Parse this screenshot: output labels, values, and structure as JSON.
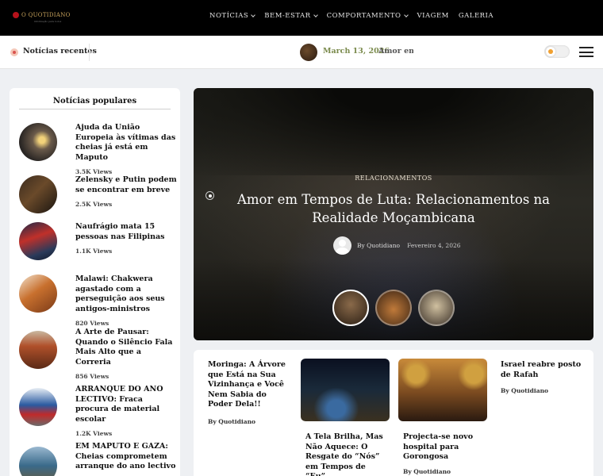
{
  "header": {
    "logo_text": "O QUOTIDIANO",
    "logo_tagline": "informação para todos",
    "nav": [
      {
        "label": "NOTÍCIAS",
        "has_dropdown": true
      },
      {
        "label": "BEM-ESTAR",
        "has_dropdown": true
      },
      {
        "label": "COMPORTAMENTO",
        "has_dropdown": true
      },
      {
        "label": "VIAGEM",
        "has_dropdown": false
      },
      {
        "label": "GALERIA",
        "has_dropdown": false
      }
    ]
  },
  "ticker": {
    "label": "Notícias recentes",
    "date": "March 13, 2026",
    "title": "Amor em T"
  },
  "sidebar": {
    "title": "Notícias populares",
    "items": [
      {
        "headline": "Ajuda da União Europeia às vítimas das cheias já está em Maputo",
        "views": "3.5K Views"
      },
      {
        "headline": "Zelensky e Putin podem se encontrar em breve",
        "views": "2.5K Views"
      },
      {
        "headline": "Naufrágio mata 15 pessoas nas Filipinas",
        "views": "1.1K Views"
      },
      {
        "headline": "Malawi: Chakwera agastado com a perseguição aos seus antigos-ministros",
        "views": "820 Views"
      },
      {
        "headline": "A Arte de Pausar: Quando o Silêncio Fala Mais Alto que a Correria",
        "views": "856 Views"
      },
      {
        "headline": "ARRANQUE DO ANO LECTIVO: Fraca procura de material escolar",
        "views": "1.2K Views"
      },
      {
        "headline": "EM MAPUTO E GAZA: Cheias comprometem arranque do ano lectivo",
        "views": ""
      }
    ]
  },
  "hero": {
    "category": "RELACIONAMENTOS",
    "title": "Amor em Tempos de Luta: Relacionamentos na Realidade Moçambicana",
    "author": "By Quotidiano",
    "date": "Fevereiro 4, 2026"
  },
  "grid": {
    "articles": [
      {
        "title": "Moringa: A Árvore que Está na Sua Vizinhança e Você Nem Sabia do Poder Dela!!",
        "author": "By Quotidiano"
      },
      {
        "title": "A Tela Brilha, Mas Não Aquece: O Resgate do “Nós” em Tempos de “Eu”",
        "author": ""
      },
      {
        "title": "Projecta-se novo hospital para Gorongosa",
        "author": "By Quotidiano"
      },
      {
        "title": "Israel reabre posto de Rafah",
        "author": "By Quotidiano"
      }
    ]
  },
  "colors": {
    "topbar_bg": "#000000",
    "page_bg": "#eef0f3",
    "ticker_date": "#7a8a4c",
    "accent_red": "#d9534f"
  }
}
